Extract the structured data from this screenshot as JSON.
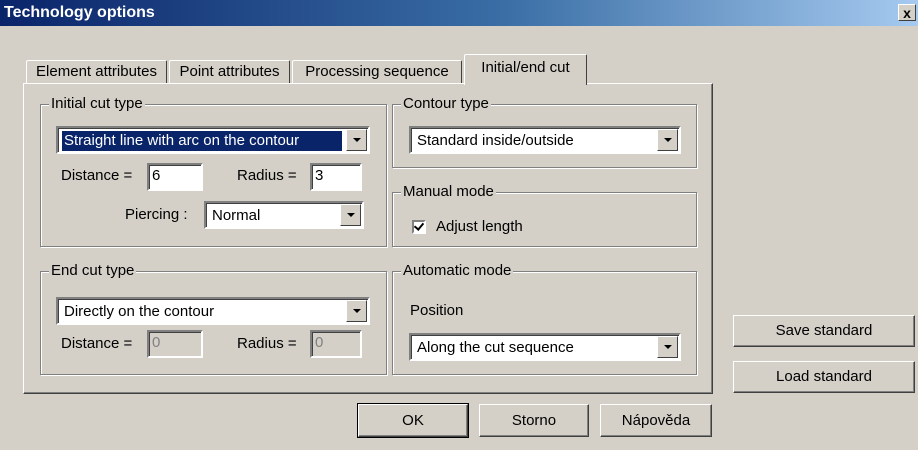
{
  "window": {
    "title": "Technology options",
    "close_label": "x"
  },
  "tabs": [
    {
      "label": "Element attributes"
    },
    {
      "label": "Point attributes"
    },
    {
      "label": "Processing sequence"
    },
    {
      "label": "Initial/end cut"
    }
  ],
  "initial_cut": {
    "legend": "Initial cut type",
    "type_value": "Straight line with arc on the contour",
    "distance_label": "Distance =",
    "distance_value": "6",
    "radius_label": "Radius =",
    "radius_value": "3",
    "piercing_label": "Piercing :",
    "piercing_value": "Normal"
  },
  "contour": {
    "legend": "Contour type",
    "type_value": "Standard inside/outside"
  },
  "manual": {
    "legend": "Manual mode",
    "adjust_label": "Adjust length",
    "adjust_checked": true
  },
  "end_cut": {
    "legend": "End cut type",
    "type_value": "Directly on the contour",
    "distance_label": "Distance =",
    "distance_value": "0",
    "radius_label": "Radius =",
    "radius_value": "0"
  },
  "automatic": {
    "legend": "Automatic mode",
    "position_label": "Position",
    "position_value": "Along the cut sequence"
  },
  "buttons": {
    "save_standard": "Save standard",
    "load_standard": "Load standard",
    "ok": "OK",
    "cancel": "Storno",
    "help": "Nápověda"
  }
}
